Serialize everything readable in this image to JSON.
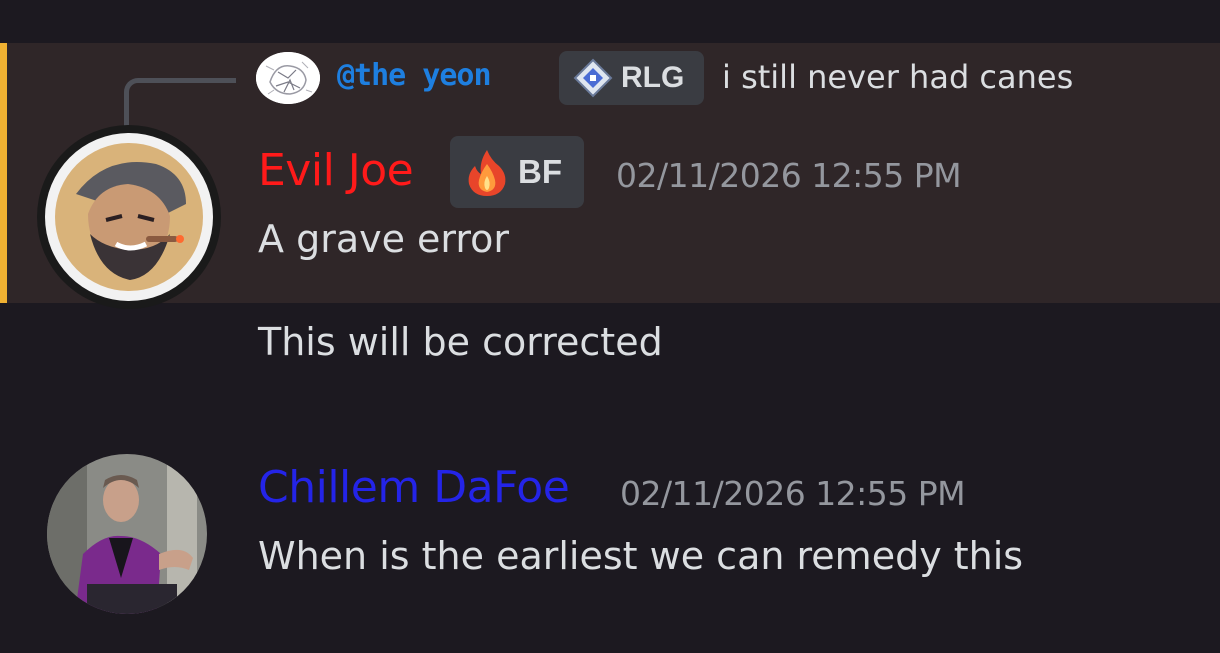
{
  "colors": {
    "background": "#1c1920",
    "mention_highlight": "#2f2628",
    "mention_bar": "#f0b132",
    "reply_username": "#1e7fe0",
    "evil_joe_name": "#ff1a1a",
    "chillem_name": "#2424e8",
    "timestamp": "#94979e",
    "message_text": "#dbdee1",
    "tag_background": "#3a3c42"
  },
  "reply": {
    "avatar_icon": "sketch-avatar",
    "username": "@the yeon",
    "tag": {
      "icon": "diamond-compass-icon",
      "label": "RLG"
    },
    "text": "i still never had canes"
  },
  "messages": [
    {
      "author": "Evil Joe",
      "avatar_icon": "bearded-pirate-avatar",
      "tag": {
        "icon": "fire-icon",
        "label": "BF"
      },
      "timestamp": "02/11/2026 12:55 PM",
      "lines": [
        "A grave error",
        "This will be corrected"
      ]
    },
    {
      "author": "Chillem DaFoe",
      "avatar_icon": "man-purple-suit-avatar",
      "timestamp": "02/11/2026 12:55 PM",
      "lines": [
        "When is the earliest we can remedy this"
      ]
    }
  ]
}
